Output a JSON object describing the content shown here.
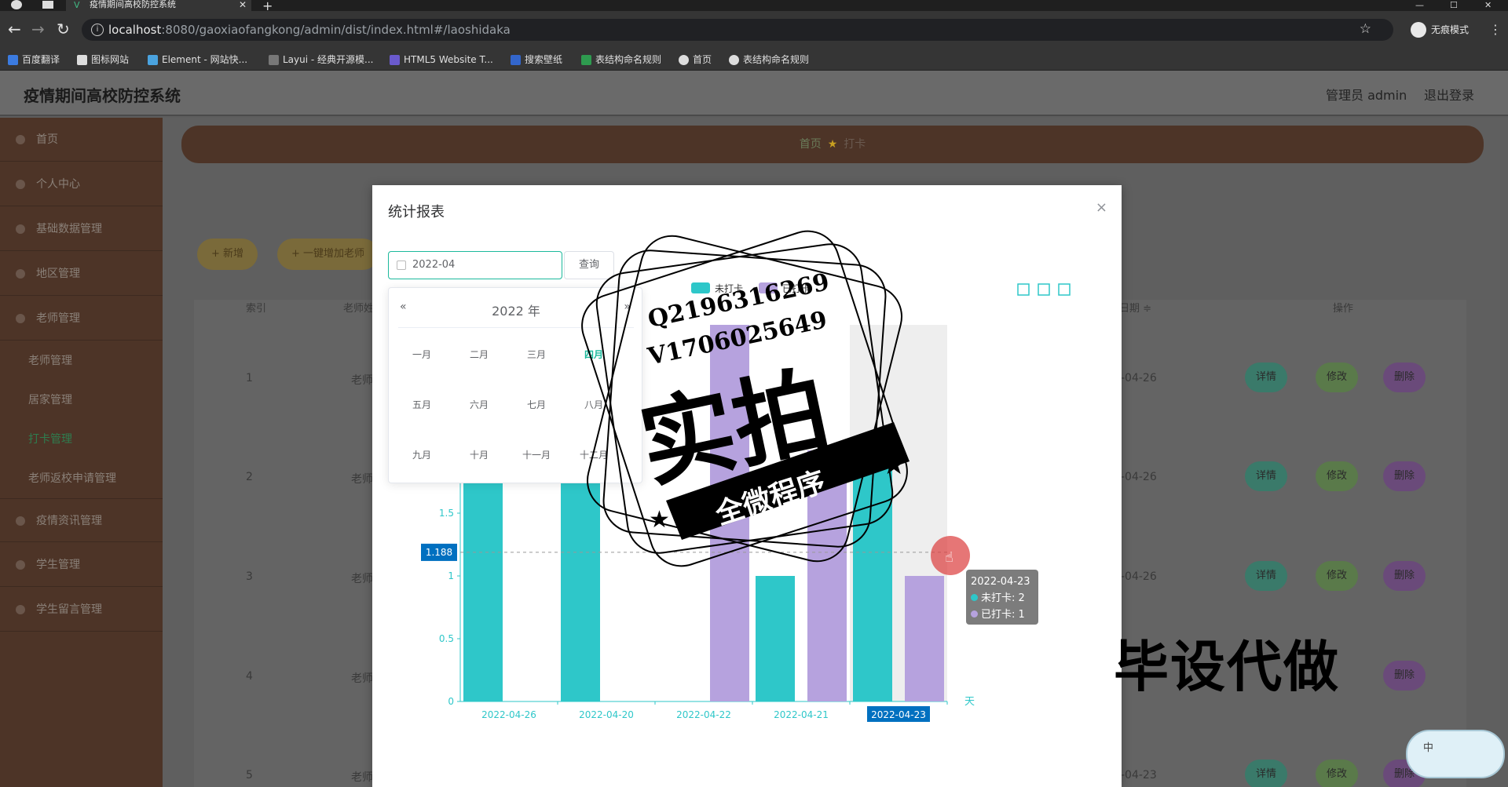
{
  "browser": {
    "tab_title": "疫情期间高校防控系统",
    "tab_close": "✕",
    "tab_new": "+",
    "url_host": "localhost",
    "url_rest": ":8080/gaoxiaofangkong/admin/dist/index.html#/laoshidaka",
    "incognito_label": "无痕模式",
    "bookmarks": [
      "百度翻译",
      "图标网站",
      "Element - 网站快...",
      "Layui - 经典开源模...",
      "HTML5 Website T...",
      "搜索壁纸",
      "表结构命名规则",
      "首页",
      "表结构命名规则"
    ]
  },
  "app": {
    "title": "疫情期间高校防控系统",
    "user_label": "管理员 admin",
    "logout_label": "退出登录"
  },
  "sidebar": {
    "items": [
      "首页",
      "个人中心",
      "基础数据管理",
      "地区管理",
      "老师管理"
    ],
    "sub_items": [
      "老师管理",
      "居家管理",
      "打卡管理",
      "老师返校申请管理"
    ],
    "items_after": [
      "疫情资讯管理",
      "学生管理",
      "学生留言管理"
    ]
  },
  "breadcrumb": {
    "home": "首页",
    "current": "打卡"
  },
  "background": {
    "add_btn": "+ 新增",
    "bulk_btn": "+ 一键增加老师",
    "col_index": "索引",
    "col_teacher": "老师姓",
    "col_date": "日期 ≑",
    "col_action": "操作",
    "rows": [
      {
        "index": "1",
        "name": "老师",
        "date": "-04-26"
      },
      {
        "index": "2",
        "name": "老师",
        "date": "-04-26"
      },
      {
        "index": "3",
        "name": "老师",
        "date": "-04-26"
      },
      {
        "index": "4",
        "name": "老师",
        "date": ""
      },
      {
        "index": "5",
        "name": "老师",
        "date": "-04-23"
      }
    ],
    "detail_btn": "详情",
    "edit_btn": "修改",
    "delete_btn": "删除"
  },
  "dialog": {
    "title": "统计报表",
    "close": "×",
    "date_value": "2022-04",
    "query_btn": "查询",
    "picker": {
      "prev": "«",
      "next": "»",
      "year": "2022 年",
      "months": [
        "一月",
        "二月",
        "三月",
        "四月",
        "五月",
        "六月",
        "七月",
        "八月",
        "九月",
        "十月",
        "十一月",
        "十二月"
      ],
      "current_index": 3
    },
    "tooltip": {
      "date": "2022-04-23",
      "line1": "未打卡: 2",
      "line2": "已打卡: 1"
    },
    "axis_pointer_label": "1.188"
  },
  "chart_data": {
    "type": "bar",
    "categories": [
      "2022-04-26",
      "2022-04-20",
      "2022-04-22",
      "2022-04-21",
      "2022-04-23"
    ],
    "series": [
      {
        "name": "未打卡",
        "values": [
          2,
          2,
          0,
          1,
          2
        ],
        "color": "#2ec7c9"
      },
      {
        "name": "已打卡",
        "values": [
          0,
          0,
          3,
          2,
          1
        ],
        "color": "#b6a2de"
      }
    ],
    "ylim": [
      0,
      3
    ],
    "y_ticks": [
      "0",
      "0.5",
      "1",
      "1.5"
    ],
    "xlabel": "天",
    "highlight_category": "2022-04-23",
    "legend": "top-center"
  },
  "overlays": {
    "wm_qq": "Q2196316269",
    "wm_v": "V1706025649",
    "wm_big": "实拍",
    "wm_banner": "全微程序",
    "corner_text": "毕设代做",
    "widget_char": "中"
  },
  "colors": {
    "accent": "#1cb99c",
    "sidebar_bg": "#4d3427",
    "series1": "#2ec7c9",
    "series2": "#b6a2de"
  }
}
